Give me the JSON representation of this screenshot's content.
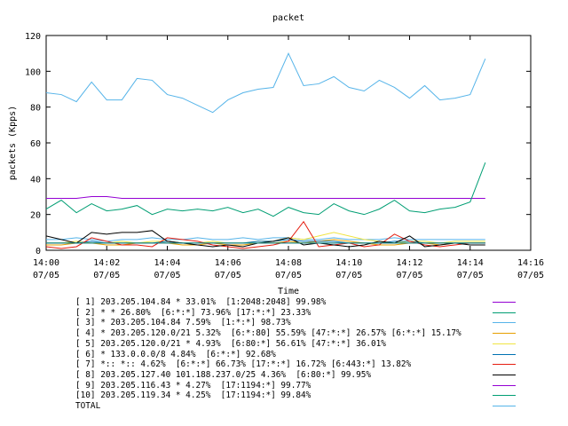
{
  "chart_data": {
    "type": "line",
    "title": "packet",
    "xlabel": "Time",
    "ylabel": "packets (Kpps)",
    "ylim": [
      0,
      120
    ],
    "y_ticks": [
      "0",
      "20",
      "40",
      "60",
      "80",
      "100",
      "120"
    ],
    "x_ticks": [
      {
        "time": "14:00",
        "date": "07/05"
      },
      {
        "time": "14:02",
        "date": "07/05"
      },
      {
        "time": "14:04",
        "date": "07/05"
      },
      {
        "time": "14:06",
        "date": "07/05"
      },
      {
        "time": "14:08",
        "date": "07/05"
      },
      {
        "time": "14:10",
        "date": "07/05"
      },
      {
        "time": "14:12",
        "date": "07/05"
      },
      {
        "time": "14:14",
        "date": "07/05"
      },
      {
        "time": "14:16",
        "date": "07/05"
      }
    ],
    "x_minutes": [
      0,
      0.5,
      1,
      1.5,
      2,
      2.5,
      3,
      3.5,
      4,
      4.5,
      5,
      5.5,
      6,
      6.5,
      7,
      7.5,
      8,
      8.5,
      9,
      9.5,
      10,
      10.5,
      11,
      11.5,
      12,
      12.5,
      13,
      13.5,
      14,
      14.5
    ],
    "series": [
      {
        "name": "[ 1] 203.205.104.84 * 33.01%  [1:2048:2048] 99.98%",
        "color": "#9400d3",
        "values": [
          29,
          29,
          29,
          30,
          30,
          29,
          29,
          29,
          29,
          29,
          29,
          29,
          29,
          29,
          29,
          29,
          29,
          29,
          29,
          29,
          29,
          29,
          29,
          29,
          29,
          29,
          29,
          29,
          29,
          29
        ]
      },
      {
        "name": "[ 2] * * 26.80%  [6:*:*] 73.96% [17:*:*] 23.33%",
        "color": "#009e73",
        "values": [
          23,
          28,
          21,
          26,
          22,
          23,
          25,
          20,
          23,
          22,
          23,
          22,
          24,
          21,
          23,
          19,
          24,
          21,
          20,
          26,
          22,
          20,
          23,
          28,
          22,
          21,
          23,
          24,
          27,
          49
        ]
      },
      {
        "name": "[ 3] * 203.205.104.84 7.59%  [1:*:*] 98.73%",
        "color": "#56b4e9",
        "values": [
          6,
          6,
          7,
          6,
          5,
          6,
          6,
          7,
          6,
          6,
          7,
          6,
          6,
          7,
          6,
          7,
          7,
          6,
          6,
          7,
          6,
          6,
          6,
          7,
          6,
          6,
          6,
          6,
          6,
          6
        ]
      },
      {
        "name": "[ 4] * 203.205.120.0/21 5.32%  [6:*:80] 55.59% [47:*:*] 26.57% [6:*:*] 15.17%",
        "color": "#e69f00",
        "values": [
          3,
          3,
          4,
          4,
          3,
          3,
          4,
          4,
          4,
          3,
          3,
          4,
          3,
          3,
          4,
          4,
          5,
          4,
          5,
          6,
          5,
          4,
          3,
          3,
          4,
          4,
          3,
          4,
          4,
          4
        ]
      },
      {
        "name": "[ 5] 203.205.120.0/21 * 4.93%  [6:80:*] 56.61% [47:*:*] 36.01%",
        "color": "#f0e442",
        "values": [
          4,
          4,
          5,
          4,
          4,
          5,
          4,
          5,
          5,
          4,
          4,
          5,
          4,
          4,
          5,
          5,
          7,
          6,
          8,
          10,
          8,
          6,
          5,
          4,
          5,
          5,
          4,
          5,
          5,
          5
        ]
      },
      {
        "name": "[ 6] * 133.0.0.0/8 4.84%  [6:*:*] 92.68%",
        "color": "#0072b2",
        "values": [
          4,
          4,
          4,
          5,
          4,
          4,
          4,
          4,
          5,
          4,
          4,
          4,
          4,
          4,
          5,
          5,
          6,
          5,
          5,
          5,
          4,
          4,
          4,
          5,
          5,
          4,
          4,
          4,
          4,
          4
        ]
      },
      {
        "name": "[ 7] *:: *:: 4.62%  [6:*:*] 66.73% [17:*:*] 16.72% [6:443:*] 13.82%",
        "color": "#e51e10",
        "values": [
          2,
          1,
          2,
          7,
          5,
          3,
          3,
          2,
          7,
          6,
          5,
          3,
          2,
          1,
          2,
          3,
          5,
          16,
          2,
          3,
          4,
          2,
          3,
          9,
          5,
          3,
          2,
          3,
          4,
          4
        ]
      },
      {
        "name": "[ 8] 203.205.127.40 101.188.237.0/25 4.36%  [6:80:*] 99.95%",
        "color": "#000000",
        "values": [
          8,
          6,
          4,
          10,
          9,
          10,
          10,
          11,
          5,
          4,
          3,
          2,
          3,
          2,
          4,
          5,
          7,
          3,
          4,
          3,
          2,
          3,
          5,
          4,
          8,
          2,
          3,
          4,
          3,
          3
        ]
      },
      {
        "name": "[ 9] 203.205.116.43 * 4.27%  [17:1194:*] 99.77%",
        "color": "#9400d3",
        "values": [
          4,
          4,
          4,
          4,
          4,
          4,
          4,
          4,
          4,
          4,
          4,
          4,
          4,
          4,
          4,
          4,
          4,
          4,
          4,
          4,
          4,
          4,
          4,
          4,
          4,
          4,
          4,
          4,
          4,
          4
        ]
      },
      {
        "name": "[10] 203.205.119.34 * 4.25%  [17:1194:*] 99.84%",
        "color": "#009e73",
        "values": [
          4,
          4,
          4,
          4,
          4,
          4,
          4,
          4,
          4,
          4,
          4,
          4,
          4,
          4,
          4,
          4,
          4,
          4,
          4,
          4,
          4,
          4,
          4,
          4,
          4,
          4,
          4,
          4,
          4,
          4
        ]
      },
      {
        "name": "TOTAL",
        "color": "#56b4e9",
        "values": [
          88,
          87,
          83,
          94,
          84,
          84,
          96,
          95,
          87,
          85,
          81,
          77,
          84,
          88,
          90,
          91,
          110,
          92,
          93,
          97,
          91,
          89,
          95,
          91,
          85,
          92,
          84,
          85,
          87,
          107
        ]
      }
    ],
    "grid": false,
    "legend_position": "bottom"
  }
}
